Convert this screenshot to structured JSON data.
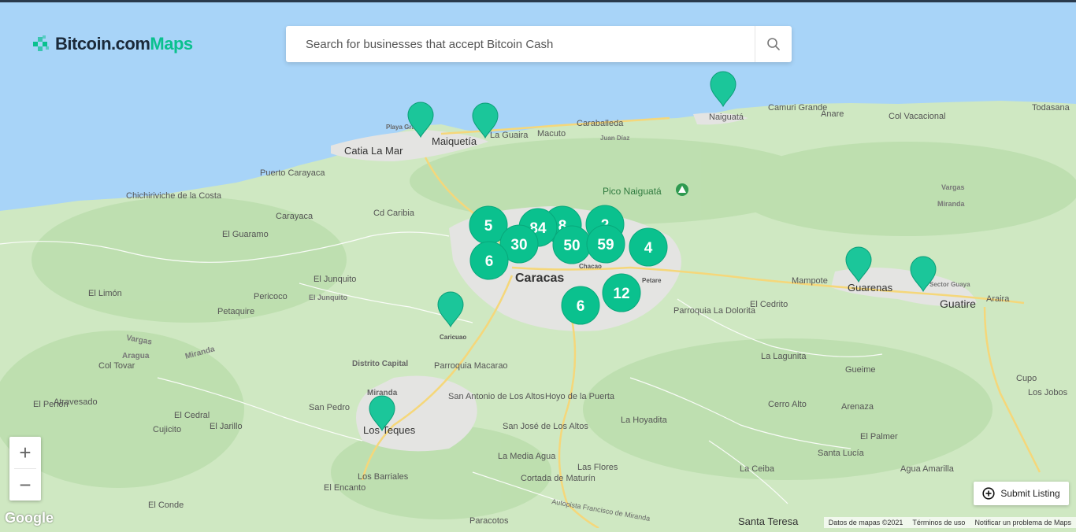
{
  "brand": {
    "name_part1": "Bitcoin.com",
    "name_part2": "Maps",
    "accent": "#0ac18e"
  },
  "search": {
    "placeholder": "Search for businesses that accept Bitcoin Cash",
    "icon": "search-icon"
  },
  "zoom": {
    "in_label": "+",
    "out_label": "−"
  },
  "submit": {
    "label": "Submit Listing",
    "icon": "plus-circle-icon"
  },
  "attribution": {
    "google": "Google",
    "data": "Datos de mapas ©2021",
    "terms": "Términos de uso",
    "report": "Notificar un problema de Maps"
  },
  "clusters": [
    {
      "count": "5"
    },
    {
      "count": "84"
    },
    {
      "count": "8"
    },
    {
      "count": "2"
    },
    {
      "count": "30"
    },
    {
      "count": "50"
    },
    {
      "count": "59"
    },
    {
      "count": "4"
    },
    {
      "count": "6"
    },
    {
      "count": "12"
    },
    {
      "count": "6"
    }
  ],
  "pins": [
    "pin",
    "pin",
    "pin",
    "pin",
    "pin",
    "pin",
    "pin"
  ],
  "places": [
    "Playa Grande",
    "Maiquetía",
    "La Guaira",
    "Macuto",
    "Caraballeda",
    "Juan Díaz",
    "Naiguatá",
    "Camuri Grande",
    "Anare",
    "Col Vacacional",
    "Todasana",
    "Catia La Mar",
    "Puerto Carayaca",
    "Chichiriviche de la Costa",
    "Carayaca",
    "Cd Caribia",
    "Pico Naiguatá",
    "Vargas",
    "Miranda",
    "El Guaramo",
    "Caracas",
    "Chacao",
    "Petare",
    "El Junquito",
    "El Limón",
    "Pericoco",
    "Petaquire",
    "Caricuao",
    "Mampote",
    "Guarenas",
    "Sector Guaya",
    "Guatire",
    "Araira",
    "El Cedrito",
    "Parroquia La Dolorita",
    "La Lagunita",
    "Gueime",
    "Distrito Capital",
    "Parroquia Macarao",
    "Col Tovar",
    "Aragua",
    "Atravesado",
    "El Penon",
    "San Antonio de Los Altos",
    "Hoyo de la Puerta",
    "San Pedro",
    "Los Teques",
    "El Cedral",
    "El Jarillo",
    "Cujicito",
    "San José de Los Altos",
    "La Hoyadita",
    "Cerro Alto",
    "Arenaza",
    "El Palmer",
    "Santa Lucía",
    "Agua Amarilla",
    "La Media Agua",
    "Las Flores",
    "La Ceiba",
    "Los Barriales",
    "El Encanto",
    "Cortada de Maturín",
    "El Conde",
    "Paracotos",
    "Santa Teresa",
    "Cupo",
    "Los Jobos",
    "Autopista Francisco de Miranda",
    "El Junquito"
  ]
}
